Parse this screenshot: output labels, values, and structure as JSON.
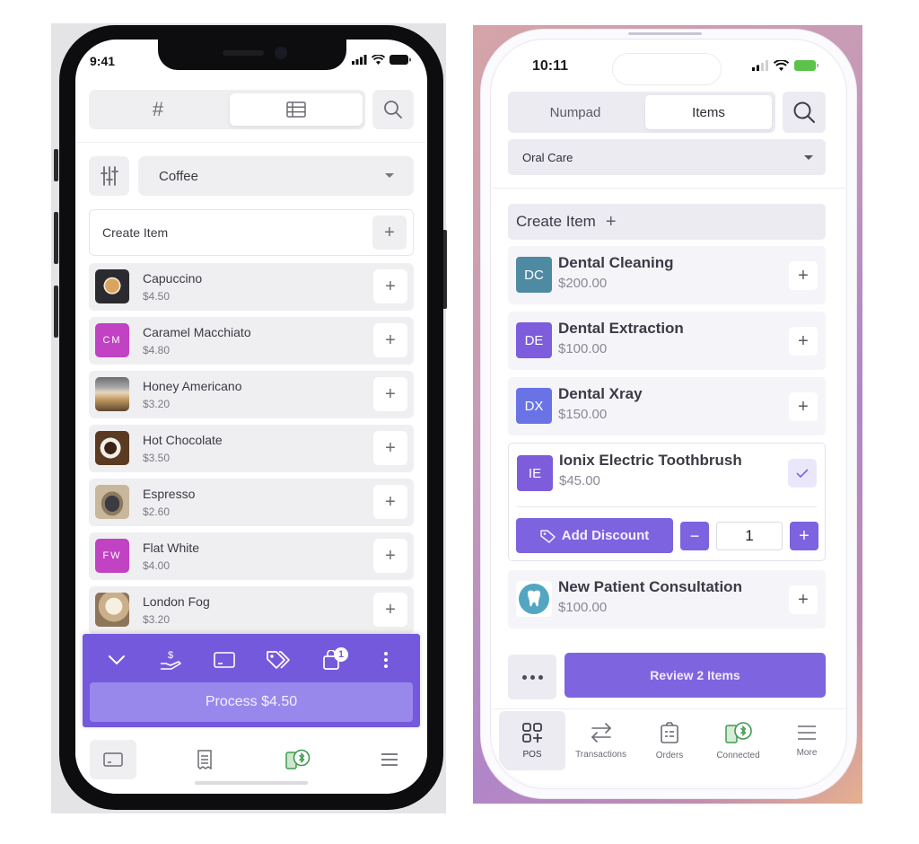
{
  "left_app": {
    "status_bar": {
      "time": "9:41"
    },
    "mode_toggle": {
      "options": [
        {
          "label": "#",
          "icon": "hash-icon",
          "active": false
        },
        {
          "label": "",
          "icon": "list-grid-icon",
          "active": true
        }
      ],
      "search_icon": "search-icon"
    },
    "category_filter": {
      "selected": "Coffee",
      "filter_icon": "sliders-icon"
    },
    "create_item": {
      "label": "Create Item",
      "plus": "+"
    },
    "items": [
      {
        "name": "Capuccino",
        "price": "$4.50",
        "thumb": "photo",
        "thumb_kind": "cappuccino"
      },
      {
        "name": "Caramel Macchiato",
        "price": "$4.80",
        "thumb": "initials",
        "initials": "CM",
        "color": "#c142c2"
      },
      {
        "name": "Honey Americano",
        "price": "$3.20",
        "thumb": "photo",
        "thumb_kind": "americano"
      },
      {
        "name": "Hot Chocolate",
        "price": "$3.50",
        "thumb": "photo",
        "thumb_kind": "chocolate"
      },
      {
        "name": "Espresso",
        "price": "$2.60",
        "thumb": "photo",
        "thumb_kind": "espresso"
      },
      {
        "name": "Flat White",
        "price": "$4.00",
        "thumb": "initials",
        "initials": "FW",
        "color": "#c142c2"
      },
      {
        "name": "London Fog",
        "price": "$3.20",
        "thumb": "photo",
        "thumb_kind": "londonfog"
      }
    ],
    "action_bar": {
      "icons": [
        "chevron-down-icon",
        "cash-hand-icon",
        "card-reader-icon",
        "tags-icon",
        "shopping-bag-icon",
        "more-vertical-icon"
      ],
      "cart_count": "1",
      "process_label": "Process $4.50"
    },
    "tab_bar": {
      "tabs": [
        {
          "icon": "register-icon",
          "active": true
        },
        {
          "icon": "receipt-icon",
          "active": false
        },
        {
          "icon": "bluetooth-reader-icon",
          "active": false
        },
        {
          "icon": "menu-icon",
          "active": false
        }
      ]
    },
    "colors": {
      "accent": "#7559dd",
      "process_button": "#9988ec",
      "initials_bg": "#c142c2",
      "connected_green": "#3f9a4f"
    }
  },
  "right_app": {
    "status_bar": {
      "time": "10:11"
    },
    "mode_toggle": {
      "options": [
        {
          "label": "Numpad",
          "active": false
        },
        {
          "label": "Items",
          "active": true
        }
      ]
    },
    "category_filter": {
      "selected": "Oral Care"
    },
    "create_item": {
      "label": "Create Item",
      "plus": "+"
    },
    "items": [
      {
        "name": "Dental Cleaning",
        "price": "$200.00",
        "initials": "DC",
        "color": "#4f8aa3",
        "state": "default"
      },
      {
        "name": "Dental Extraction",
        "price": "$100.00",
        "initials": "DE",
        "color": "#7d5ddc",
        "state": "default"
      },
      {
        "name": "Dental Xray",
        "price": "$150.00",
        "initials": "DX",
        "color": "#6a73e6",
        "state": "default"
      }
    ],
    "selected_item": {
      "name": "Ionix Electric Toothbrush",
      "price": "$45.00",
      "initials": "IE",
      "color": "#7d5ddc",
      "discount_label": "Add Discount",
      "quantity": "1",
      "minus": "−",
      "plus": "+"
    },
    "last_item": {
      "name": "New Patient Consultation",
      "price": "$100.00",
      "icon": "tooth-icon"
    },
    "review_label": "Review 2 Items",
    "tabs": [
      {
        "label": "POS",
        "icon": "pos-grid-icon",
        "active": true
      },
      {
        "label": "Transactions",
        "icon": "arrows-swap-icon",
        "active": false
      },
      {
        "label": "Orders",
        "icon": "clipboard-icon",
        "active": false
      },
      {
        "label": "Connected",
        "icon": "bluetooth-reader-icon",
        "active": false
      },
      {
        "label": "More",
        "icon": "menu-icon",
        "active": false
      }
    ],
    "colors": {
      "accent": "#7f64e0",
      "battery": "#5cc24a",
      "connected_green": "#3f9a4f"
    }
  }
}
